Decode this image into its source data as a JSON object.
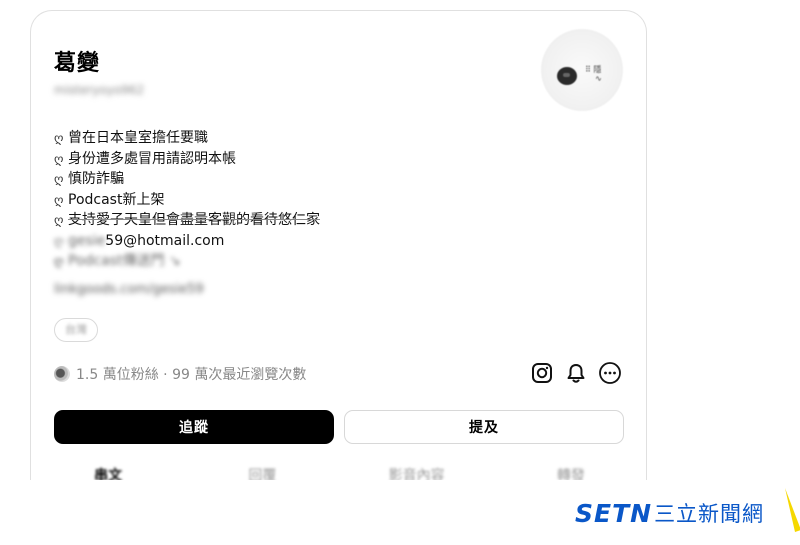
{
  "profile": {
    "name": "葛變",
    "handle": "misteryoyo962",
    "bio": [
      {
        "bullet": "ღ",
        "text": "曾在日本皇室擔任要職",
        "style": "plain"
      },
      {
        "bullet": "ღ",
        "text": "身份遭多處冒用請認明本帳",
        "style": "plain"
      },
      {
        "bullet": "ღ",
        "text": "慎防詐騙",
        "style": "plain"
      },
      {
        "bullet": "ღ",
        "text": "Podcast新上架",
        "style": "plain"
      },
      {
        "bullet": "ღ",
        "text": "支持愛子天皇但會盡量客觀的看待悠仁家",
        "style": "strike"
      },
      {
        "bullet": "ღ",
        "text_blurred": "gesie",
        "text": "59@hotmail.com",
        "style": "partial"
      },
      {
        "bullet": "ღ",
        "text": "Podcast傳送門 ↘",
        "style": "blurred"
      }
    ],
    "link": "linkgoods.com/gesie59",
    "location": "台灣",
    "stats": "1.5 萬位粉絲 · 99 萬次最近瀏覽次數"
  },
  "icons": {
    "instagram": "instagram-icon",
    "notification": "bell-icon",
    "more": "more-options-icon"
  },
  "buttons": {
    "follow": "追蹤",
    "mention": "提及"
  },
  "tabs": [
    "串文",
    "回覆",
    "影音內容",
    "轉發"
  ],
  "watermark": {
    "brand": "SETN",
    "name": "三立新聞網",
    "color": "#0a57c8",
    "accent": "#f5d800"
  }
}
